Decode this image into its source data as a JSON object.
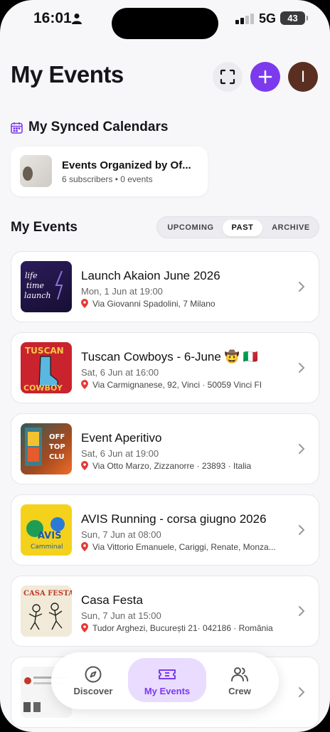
{
  "status_bar": {
    "time": "16:01",
    "network": "5G",
    "battery": "43"
  },
  "header": {
    "title": "My Events",
    "avatar_initial": "I"
  },
  "synced_calendars": {
    "title": "My Synced Calendars",
    "items": [
      {
        "name": "Events Organized by Of...",
        "meta": "6 subscribers • 0 events"
      }
    ]
  },
  "events_section": {
    "title": "My Events",
    "tabs": [
      {
        "label": "UPCOMING",
        "active": false
      },
      {
        "label": "PAST",
        "active": true
      },
      {
        "label": "ARCHIVE",
        "active": false
      }
    ]
  },
  "events": [
    {
      "title": "Launch Akaion June 2026",
      "date": "Mon, 1 Jun at 19:00",
      "location": "Via Giovanni Spadolini, 7 Milano"
    },
    {
      "title": "Tuscan Cowboys - 6-June 🤠 🇮🇹",
      "date": "Sat, 6 Jun at 16:00",
      "location": "Via Carmignanese, 92, Vinci · 50059 Vinci FI"
    },
    {
      "title": "Event Aperitivo",
      "date": "Sat, 6 Jun at 19:00",
      "location": "Via Otto Marzo, Zizzanorre · 23893 · Italia"
    },
    {
      "title": "AVIS Running - corsa giugno 2026",
      "date": "Sun, 7 Jun at 08:00",
      "location": "Via Vittorio Emanuele, Cariggi, Renate, Monza..."
    },
    {
      "title": "Casa Festa",
      "date": "Sun, 7 Jun at 15:00",
      "location": "Tudor Arghezi, București 21· 042186 · România"
    }
  ],
  "thumb_text": {
    "launch": "life time launch",
    "tuscan": "TUSCAN COWBOY",
    "aperitivo": "OFF TOP CLU",
    "avis": "AVIS Camminal",
    "casa": "CASA FESTA"
  },
  "bottom_nav": [
    {
      "label": "Discover",
      "icon": "compass-icon",
      "active": false
    },
    {
      "label": "My Events",
      "icon": "ticket-icon",
      "active": true
    },
    {
      "label": "Crew",
      "icon": "people-icon",
      "active": false
    }
  ],
  "colors": {
    "accent": "#7c3aed",
    "accent_soft": "#e9dcff",
    "pin": "#e53935",
    "avatar": "#5a2f22"
  }
}
